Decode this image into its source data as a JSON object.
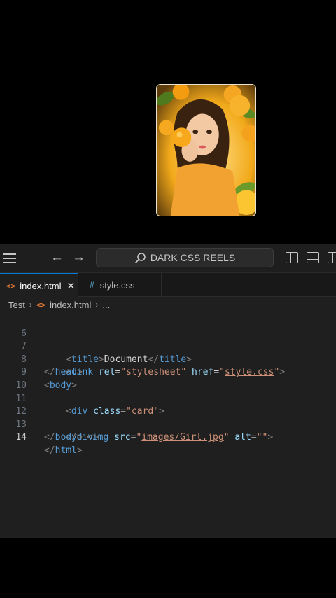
{
  "preview": {
    "card_image_alt": ""
  },
  "titlebar": {
    "search_label": "DARK CSS REELS",
    "back_arrow": "←",
    "forward_arrow": "→"
  },
  "tabs": [
    {
      "label": "index.html",
      "icon": "<>",
      "close": "✕"
    },
    {
      "label": "style.css",
      "icon": "#"
    }
  ],
  "breadcrumb": {
    "folder": "Test",
    "file_icon": "<>",
    "file": "index.html",
    "more": "...",
    "sep": "›"
  },
  "code_lines": [
    {
      "num": "6",
      "parts": {
        "a": "<",
        "b": "title",
        "c": ">",
        "d": "Document",
        "e": "</",
        "f": "title",
        "g": ">"
      }
    },
    {
      "num": "7",
      "parts": {
        "a": "<",
        "b": "link",
        "c": " ",
        "d": "rel",
        "e": "=",
        "f": "\"stylesheet\"",
        "g": " ",
        "h": "href",
        "i": "=",
        "j": "\"",
        "k": "style.css",
        "l": "\"",
        "m": ">"
      }
    },
    {
      "num": "8",
      "parts": {
        "a": "</",
        "b": "head",
        "c": ">"
      }
    },
    {
      "num": "9",
      "parts": {
        "a": "<",
        "b": "body",
        "c": ">"
      }
    },
    {
      "num": "10",
      "parts": {
        "a": "<",
        "b": "div",
        "c": " ",
        "d": "class",
        "e": "=",
        "f": "\"card\"",
        "g": ">"
      }
    },
    {
      "num": "11",
      "parts": {
        "a": "<",
        "b": "img",
        "c": " ",
        "d": "src",
        "e": "=",
        "f": "\"",
        "g": "images/Girl.jpg",
        "h": "\"",
        "i": " ",
        "j": "alt",
        "k": "=",
        "l": "\"\"",
        "m": ">"
      }
    },
    {
      "num": "12",
      "parts": {
        "a": "</",
        "b": "div",
        "c": ">"
      }
    },
    {
      "num": "13",
      "parts": {
        "a": "</",
        "b": "body",
        "c": ">"
      }
    },
    {
      "num": "14",
      "parts": {
        "a": "</",
        "b": "html",
        "c": ">"
      }
    }
  ],
  "colors": {
    "tag": "#569cd6",
    "attribute": "#9cdcfe",
    "string": "#ce9178",
    "accent": "#0078d4",
    "html_icon": "#e37933",
    "css_icon": "#519aba"
  },
  "icons": [
    "menu-icon",
    "search-icon",
    "toggle-sidebar-icon",
    "toggle-panel-icon",
    "html-file-icon",
    "css-file-icon"
  ]
}
